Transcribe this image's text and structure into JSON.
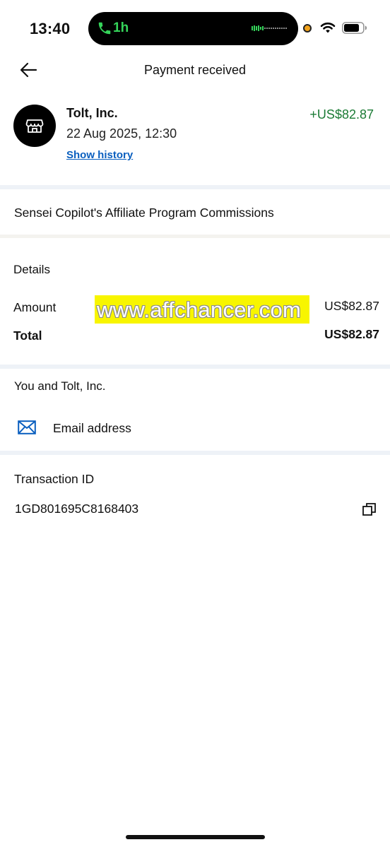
{
  "status_bar": {
    "time": "13:40",
    "call_duration": "1h",
    "call_icon": "phone-icon",
    "icons": [
      "camera-indicator-icon",
      "wifi-icon",
      "battery-icon"
    ]
  },
  "header": {
    "title": "Payment received",
    "back_icon": "arrow-left-icon"
  },
  "merchant": {
    "icon": "storefront-icon",
    "name": "Tolt, Inc.",
    "date": "22 Aug 2025, 12:30",
    "show_history_label": "Show history",
    "amount": "+US$82.87",
    "amount_color": "#1b7b35"
  },
  "note": "Sensei Copilot's Affiliate Program Commissions",
  "details": {
    "heading": "Details",
    "amount_label": "Amount",
    "amount_value": "US$82.87",
    "total_label": "Total",
    "total_value": "US$82.87"
  },
  "watermark": "www.affchancer.com",
  "contact": {
    "heading": "You and Tolt, Inc.",
    "email_icon": "mail-icon",
    "email_label": "Email address"
  },
  "transaction": {
    "heading": "Transaction ID",
    "id": "1GD801695C8168403",
    "copy_icon": "copy-icon"
  },
  "colors": {
    "link": "#0a5fbf",
    "positive_amount": "#1b7b35",
    "icon_blue": "#0a5fbf",
    "divider": "#eef2f7"
  }
}
